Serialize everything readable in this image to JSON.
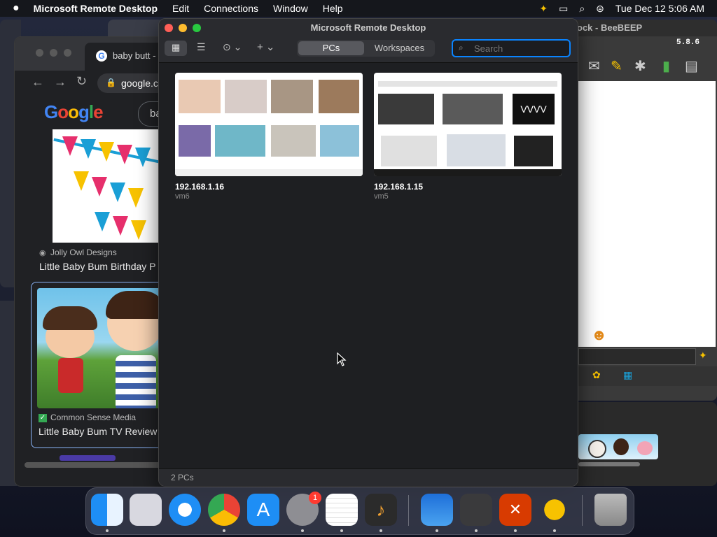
{
  "menubar": {
    "app_name": "Microsoft Remote Desktop",
    "items": [
      "Edit",
      "Connections",
      "Window",
      "Help"
    ],
    "clock": "Tue Dec 12  5:06 AM"
  },
  "rd": {
    "title": "Microsoft Remote Desktop",
    "tabs": [
      {
        "label": "PCs",
        "active": true
      },
      {
        "label": "Workspaces",
        "active": false
      }
    ],
    "search_placeholder": "Search",
    "pcs": [
      {
        "ip": "192.168.1.16",
        "name": "vm6"
      },
      {
        "ip": "192.168.1.15",
        "name": "vm5"
      }
    ],
    "status": "2 PCs",
    "thumb2_text": "VVVV"
  },
  "chrome": {
    "tab_title": "baby butt -",
    "address": "google.c",
    "search_text": "ba",
    "result1": {
      "source": "Jolly Owl Designs",
      "title": "Little Baby Bum Birthday P"
    },
    "result2": {
      "source": "Common Sense Media",
      "title": "Little Baby Bum TV Review"
    }
  },
  "beebeep": {
    "title": "ock - BeeBEEP",
    "version": "5.8.6"
  },
  "dock": {
    "notification_badge": "1",
    "apps": [
      "Finder",
      "Launchpad",
      "Safari",
      "Google Chrome",
      "App Store",
      "System Settings",
      "TextEdit",
      "GarageBand",
      "Weather",
      "Calculator",
      "Microsoft Remote Desktop",
      "BeeBEEP",
      "Trash"
    ]
  },
  "colors": {
    "accent": "#0a84ff",
    "menubar": "#15171c",
    "window": "#1e1f22"
  }
}
